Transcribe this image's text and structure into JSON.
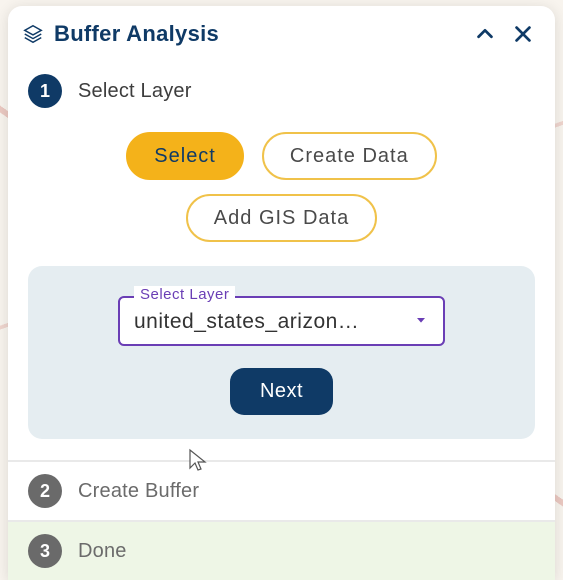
{
  "header": {
    "title": "Buffer Analysis"
  },
  "steps": [
    {
      "num": "1",
      "title": "Select Layer",
      "state": "active"
    },
    {
      "num": "2",
      "title": "Create Buffer",
      "state": "future"
    },
    {
      "num": "3",
      "title": "Done",
      "state": "success"
    }
  ],
  "tabs": {
    "select": "Select",
    "create_data": "Create Data",
    "add_gis": "Add GIS Data"
  },
  "layer_field": {
    "label": "Select Layer",
    "value": "united_states_arizon…"
  },
  "buttons": {
    "next": "Next"
  }
}
